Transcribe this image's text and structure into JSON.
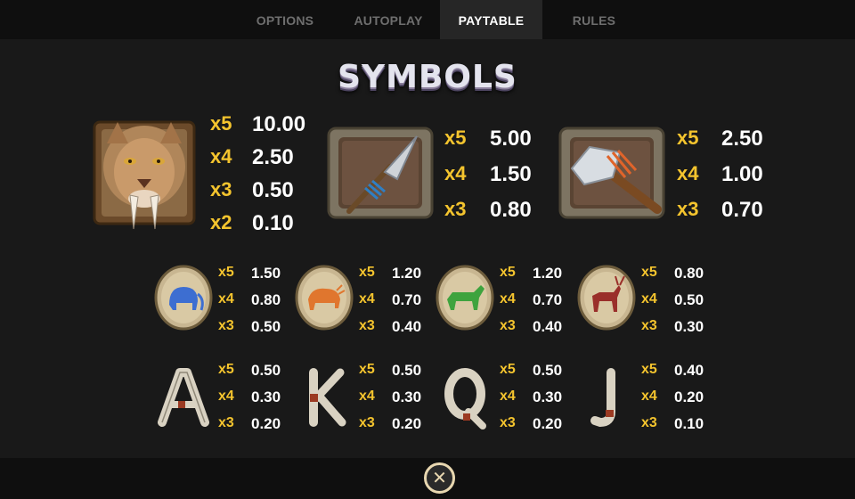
{
  "tabs": [
    {
      "label": "OPTIONS"
    },
    {
      "label": "AUTOPLAY"
    },
    {
      "label": "PAYTABLE"
    },
    {
      "label": "RULES"
    }
  ],
  "active_tab": "PAYTABLE",
  "heading": "SYMBOLS",
  "colors": {
    "multiplier": "#f4c42e",
    "value": "#ffffff",
    "background": "#191919",
    "bar": "#0f0f0f",
    "active_tab": "#262626"
  },
  "symbols": [
    {
      "icon": "sabertooth-icon",
      "pays": [
        {
          "mult": "x5",
          "value": "10.00"
        },
        {
          "mult": "x4",
          "value": "2.50"
        },
        {
          "mult": "x3",
          "value": "0.50"
        },
        {
          "mult": "x2",
          "value": "0.10"
        }
      ]
    },
    {
      "icon": "spear-icon",
      "pays": [
        {
          "mult": "x5",
          "value": "5.00"
        },
        {
          "mult": "x4",
          "value": "1.50"
        },
        {
          "mult": "x3",
          "value": "0.80"
        }
      ]
    },
    {
      "icon": "stone-axe-icon",
      "pays": [
        {
          "mult": "x5",
          "value": "2.50"
        },
        {
          "mult": "x4",
          "value": "1.00"
        },
        {
          "mult": "x3",
          "value": "0.70"
        }
      ]
    },
    {
      "icon": "blue-mammoth-stone-icon",
      "pays": [
        {
          "mult": "x5",
          "value": "1.50"
        },
        {
          "mult": "x4",
          "value": "0.80"
        },
        {
          "mult": "x3",
          "value": "0.50"
        }
      ]
    },
    {
      "icon": "orange-bison-stone-icon",
      "pays": [
        {
          "mult": "x5",
          "value": "1.20"
        },
        {
          "mult": "x4",
          "value": "0.70"
        },
        {
          "mult": "x3",
          "value": "0.40"
        }
      ]
    },
    {
      "icon": "green-horse-stone-icon",
      "pays": [
        {
          "mult": "x5",
          "value": "1.20"
        },
        {
          "mult": "x4",
          "value": "0.70"
        },
        {
          "mult": "x3",
          "value": "0.40"
        }
      ]
    },
    {
      "icon": "red-deer-stone-icon",
      "pays": [
        {
          "mult": "x5",
          "value": "0.80"
        },
        {
          "mult": "x4",
          "value": "0.50"
        },
        {
          "mult": "x3",
          "value": "0.30"
        }
      ]
    },
    {
      "icon": "letter-a-bone-icon",
      "pays": [
        {
          "mult": "x5",
          "value": "0.50"
        },
        {
          "mult": "x4",
          "value": "0.30"
        },
        {
          "mult": "x3",
          "value": "0.20"
        }
      ]
    },
    {
      "icon": "letter-k-bone-icon",
      "pays": [
        {
          "mult": "x5",
          "value": "0.50"
        },
        {
          "mult": "x4",
          "value": "0.30"
        },
        {
          "mult": "x3",
          "value": "0.20"
        }
      ]
    },
    {
      "icon": "letter-q-bone-icon",
      "pays": [
        {
          "mult": "x5",
          "value": "0.50"
        },
        {
          "mult": "x4",
          "value": "0.30"
        },
        {
          "mult": "x3",
          "value": "0.20"
        }
      ]
    },
    {
      "icon": "letter-j-bone-icon",
      "pays": [
        {
          "mult": "x5",
          "value": "0.40"
        },
        {
          "mult": "x4",
          "value": "0.20"
        },
        {
          "mult": "x3",
          "value": "0.10"
        }
      ]
    }
  ],
  "close_button": {
    "icon": "close-icon",
    "glyph": "✕"
  }
}
